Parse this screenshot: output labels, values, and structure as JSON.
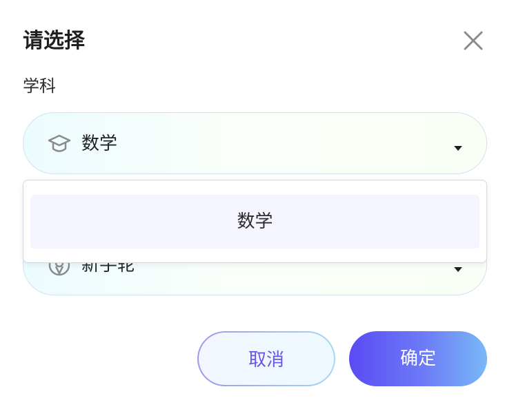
{
  "dialog": {
    "title": "请选择",
    "subject_label": "学科"
  },
  "subject_select": {
    "value": "数学",
    "icon": "graduation-cap-icon"
  },
  "level_select": {
    "value": "新手轮",
    "icon": "badge-icon"
  },
  "dropdown": {
    "options": [
      {
        "label": "数学",
        "highlighted": true
      }
    ]
  },
  "buttons": {
    "cancel": "取消",
    "confirm": "确定"
  },
  "colors": {
    "accent": "#5a4bf5",
    "accent_end": "#78b8f6",
    "cancel_text": "#6a55e6"
  }
}
